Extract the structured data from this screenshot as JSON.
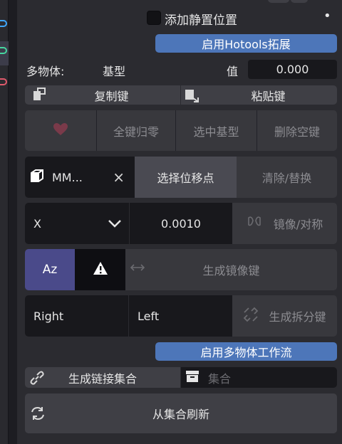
{
  "top": {
    "static_checkbox_label": "添加静置位置",
    "dot": "•",
    "hotools_button": "启用Hotools拓展"
  },
  "multi": {
    "label": "多物体:",
    "base": "基型",
    "value_label": "值",
    "value": "0.000"
  },
  "copypaste": {
    "copy": "复制键",
    "paste": "粘贴键"
  },
  "keys": {
    "heart_icon": "heart-icon",
    "zero": "全键归零",
    "select_base": "选中基型",
    "delete_empty": "删除空键"
  },
  "target": {
    "name": "MM...",
    "close": "×",
    "select_move": "选择位移点",
    "clear_replace": "清除/替换"
  },
  "axis": {
    "value": "X",
    "number": "0.0010",
    "mirror": "镜像/对称"
  },
  "gen": {
    "az_label": "Az",
    "mirror_keys": "生成镜像键"
  },
  "split": {
    "right": "Right",
    "left": "Left",
    "split_keys": "生成拆分键"
  },
  "workflow": {
    "button": "启用多物体工作流"
  },
  "collection": {
    "link_button": "生成链接集合",
    "placeholder": "集合"
  },
  "refresh": {
    "button": "从集合刷新"
  }
}
